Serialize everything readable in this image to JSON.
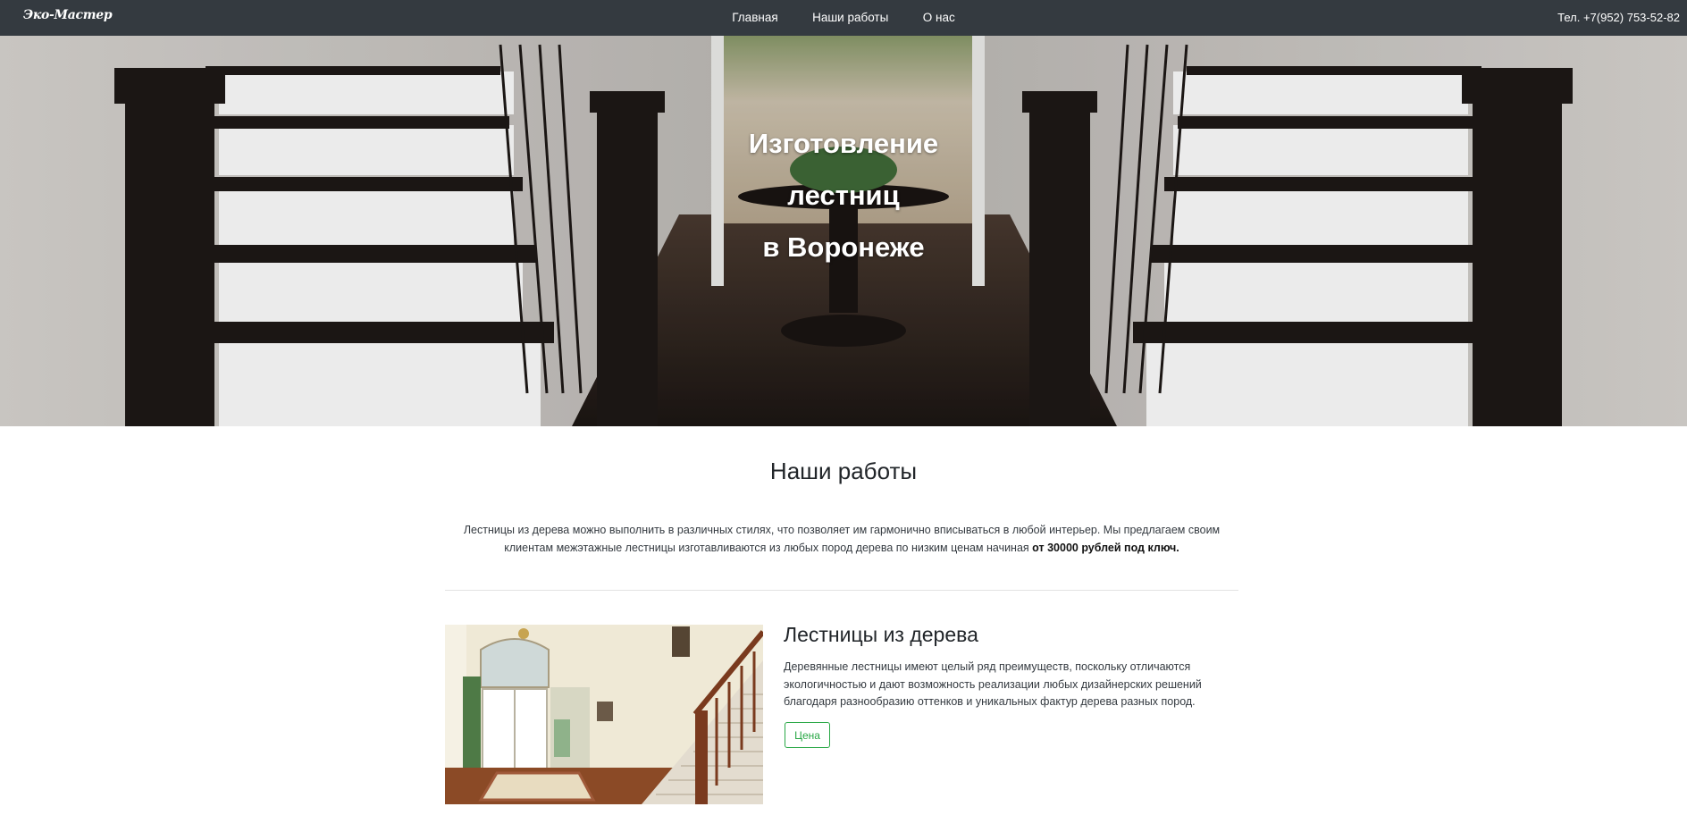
{
  "navbar": {
    "brand": "Эко-Мастер",
    "links": [
      "Главная",
      "Наши работы",
      "О нас"
    ],
    "phone": "Тел. +7(952) 753-52-82"
  },
  "hero": {
    "title_lines": [
      "Изготовление",
      "лестниц",
      "в Воронеже"
    ]
  },
  "works": {
    "title": "Наши работы",
    "lead_text": "Лестницы из дерева можно выполнить в различных стилях, что позволяет им гармонично вписываться в любой интерьер. Мы предлагаем своим клиентам межэтажные лестницы изготавливаются из любых пород дерева по низким ценам начиная ",
    "lead_bold": "от 30000 рублей под ключ."
  },
  "card": {
    "title": "Лестницы из дерева",
    "text": "Деревянные лестницы имеют целый ряд преимуществ, поскольку отличаются экологичностью и дают возможность реализации любых дизайнерских решений благодаря разнообразию оттенков и уникальных фактур дерева разных пород.",
    "button": "Цена"
  },
  "colors": {
    "navbar_bg": "#343a40",
    "button_accent": "#28a745"
  }
}
